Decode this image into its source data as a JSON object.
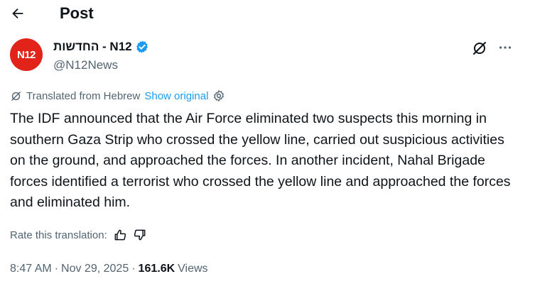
{
  "header": {
    "title": "Post",
    "back_icon": "arrow-left-icon"
  },
  "author": {
    "avatar_text": "N12",
    "name": "החדשות - N12",
    "handle": "@N12News",
    "verified_icon": "verified-badge-icon",
    "brand_color": "#e2231a"
  },
  "actions": {
    "grok_icon": "grok-icon",
    "more_icon": "more-icon"
  },
  "translation": {
    "label": "Translated from Hebrew",
    "show_original": "Show original",
    "settings_icon": "gear-icon"
  },
  "post": {
    "text": "The IDF announced that the Air Force eliminated two suspects this morning in southern Gaza Strip who crossed the yellow line, carried out suspicious activities on the ground, and approached the forces. In another incident, Nahal Brigade forces identified a terrorist who crossed the yellow line and approached the forces and eliminated him."
  },
  "rating": {
    "label": "Rate this translation:",
    "up_icon": "thumbs-up-icon",
    "down_icon": "thumbs-down-icon"
  },
  "meta": {
    "time": "8:47 AM",
    "sep1": "·",
    "date": "Nov 29, 2025",
    "sep2": "·",
    "views_count": "161.6K",
    "views_label": "Views"
  },
  "colors": {
    "accent": "#1d9bf0",
    "secondary_text": "#536471",
    "primary_text": "#0f1419"
  }
}
